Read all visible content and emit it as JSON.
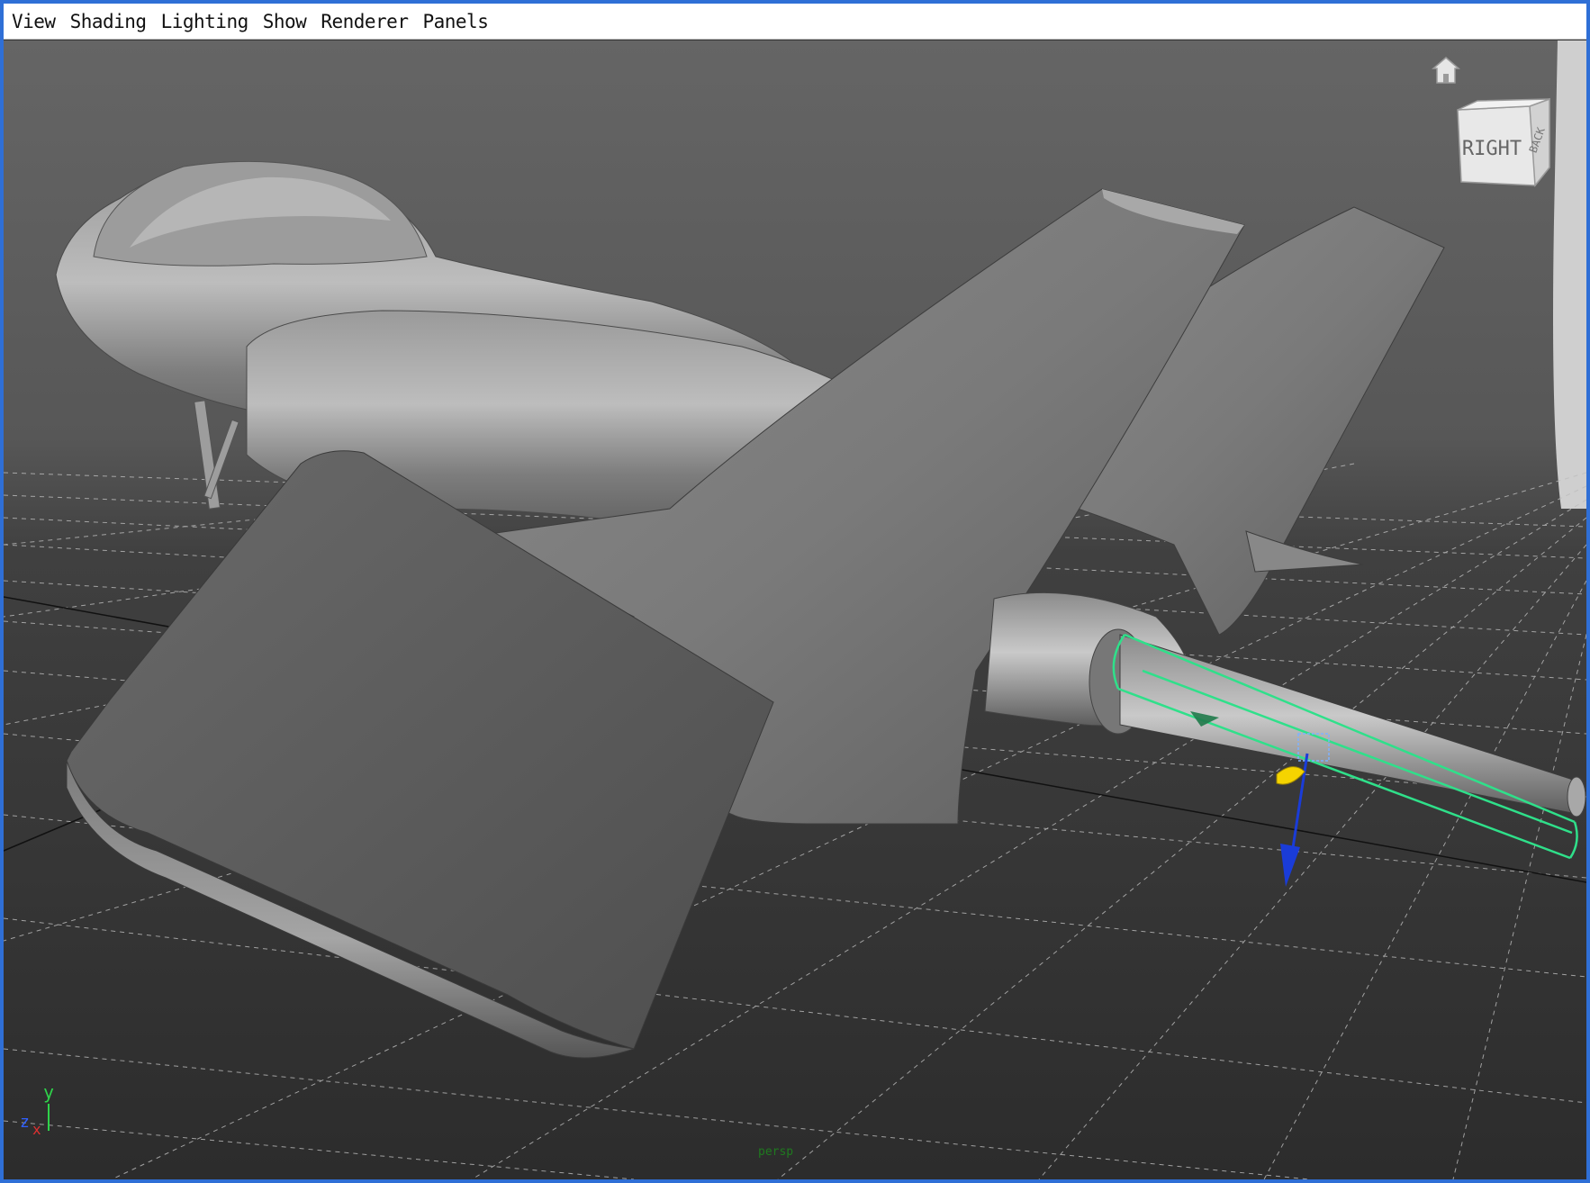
{
  "menubar": {
    "items": [
      {
        "label": "View"
      },
      {
        "label": "Shading"
      },
      {
        "label": "Lighting"
      },
      {
        "label": "Show"
      },
      {
        "label": "Renderer"
      },
      {
        "label": "Panels"
      }
    ]
  },
  "viewcube": {
    "face_front": "RIGHT",
    "face_side": "BACK"
  },
  "axis_indicator": {
    "y": "y",
    "z": "z",
    "x": "x"
  },
  "camera_label": "persp",
  "colors": {
    "window_border": "#2f6fd6",
    "selection": "#2fe08a",
    "manipulator_blue": "#1a3cd8",
    "manipulator_yellow": "#f5d400",
    "viewport_bg_top": "#6a6a6a",
    "viewport_bg_bottom": "#2e2e2e"
  },
  "icons": [
    "home-icon",
    "viewcube-icon",
    "axis-indicator-icon"
  ]
}
